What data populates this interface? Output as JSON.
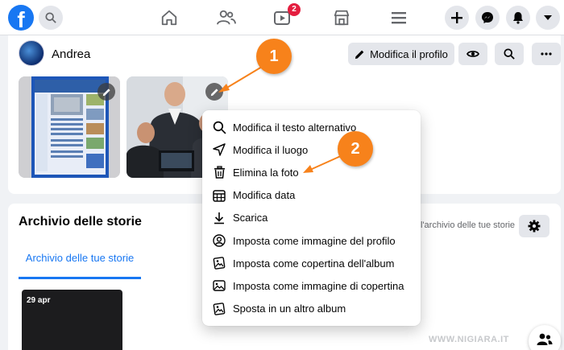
{
  "topbar": {
    "logo": "f",
    "search_icon": "search-icon",
    "nav": [
      "home-icon",
      "friends-icon",
      "watch-icon",
      "marketplace-icon",
      "menu-icon"
    ],
    "watch_badge": "2",
    "right": [
      "create-icon",
      "messenger-icon",
      "notifications-icon",
      "account-menu-icon"
    ]
  },
  "profile": {
    "name": "Andrea",
    "edit_label": "Modifica il profilo"
  },
  "menu": {
    "items": [
      {
        "label": "Modifica il testo alternativo",
        "icon": "search-icon"
      },
      {
        "label": "Modifica il luogo",
        "icon": "location-arrow-icon"
      },
      {
        "label": "Elimina la foto",
        "icon": "trash-icon"
      },
      {
        "label": "Modifica data",
        "icon": "calendar-icon"
      },
      {
        "label": "Scarica",
        "icon": "download-icon"
      },
      {
        "label": "Imposta come immagine del profilo",
        "icon": "profile-picture-icon"
      },
      {
        "label": "Imposta come copertina dell'album",
        "icon": "album-cover-icon"
      },
      {
        "label": "Imposta come immagine di copertina",
        "icon": "image-icon"
      },
      {
        "label": "Sposta in un altro album",
        "icon": "move-album-icon"
      }
    ]
  },
  "stories": {
    "title": "Archivio delle storie",
    "tab_label": "Archivio delle tue storie",
    "link_text": "l'archivio delle tue storie",
    "story_date": "29 apr"
  },
  "annotations": {
    "callout_1": "1",
    "callout_2": "2",
    "watermark": "WWW.NIGIARA.IT",
    "accent_color": "#f7821b"
  },
  "colors": {
    "brand": "#1877f2",
    "badge": "#e41e3f"
  }
}
